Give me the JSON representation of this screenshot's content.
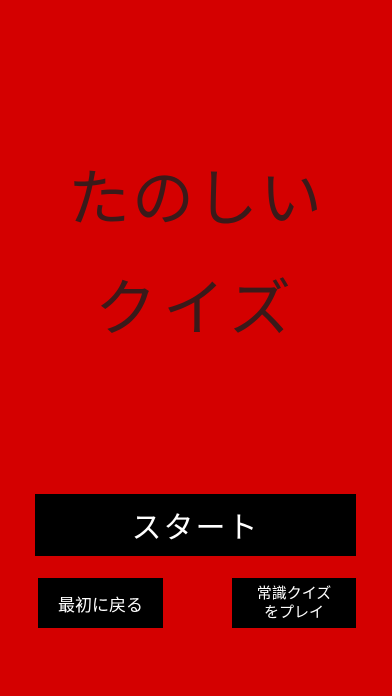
{
  "colors": {
    "background": "#d40000",
    "title_text": "#3a1a1a",
    "button_bg": "#000000",
    "button_text": "#ffffff"
  },
  "title": {
    "line1": "たのしい",
    "line2": "クイズ"
  },
  "buttons": {
    "start_label": "スタート",
    "back_label": "最初に戻る",
    "common_quiz_line1": "常識クイズ",
    "common_quiz_line2": "をプレイ"
  }
}
